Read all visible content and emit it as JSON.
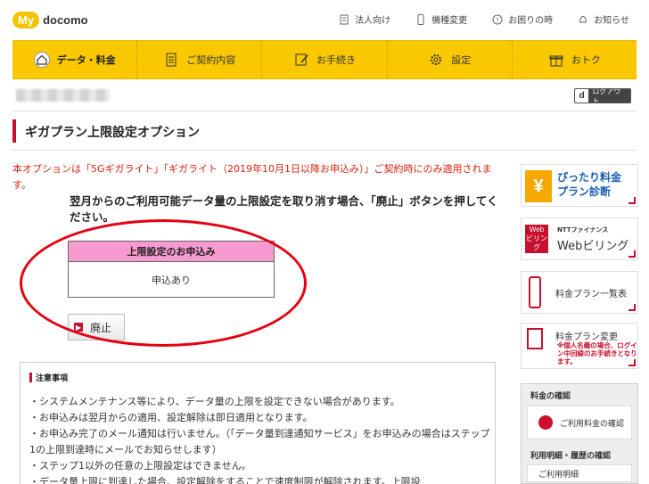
{
  "header": {
    "logo_my": "My",
    "logo_docomo": "docomo",
    "util": [
      {
        "label": "法人向け",
        "icon": "building-icon"
      },
      {
        "label": "機種変更",
        "icon": "smartphone-icon"
      },
      {
        "label": "お困りの時",
        "icon": "question-icon"
      },
      {
        "label": "お知らせ",
        "icon": "bell-icon"
      }
    ]
  },
  "nav": [
    {
      "label": "データ・料金",
      "icon": "home-icon"
    },
    {
      "label": "ご契約内容",
      "icon": "contract-icon"
    },
    {
      "label": "お手続き",
      "icon": "procedure-icon"
    },
    {
      "label": "設定",
      "icon": "gear-icon"
    },
    {
      "label": "おトク",
      "icon": "gift-icon"
    }
  ],
  "logout": {
    "d": "d",
    "label": "ログアウト"
  },
  "page_title": "ギガプラン上限設定オプション",
  "notice": "本オプションは「5Gギガライト」「ギガライト（2019年10月1日以降お申込み）」ご契約時にのみ適用されます。",
  "instruction": "翌月からのご利用可能データ量の上限設定を取り消す場合、「廃止」ボタンを押してください。",
  "status": {
    "header": "上限設定のお申込み",
    "value": "申込あり"
  },
  "cancel_button": "廃止",
  "notes": {
    "title": "注意事項",
    "items": [
      "・システムメンテナンス等により、データ量の上限を設定できない場合があります。",
      "・お申込みは翌月からの適用、設定解除は即日適用となります。",
      "・お申込み完了のメール通知は行いません。（「データ量到達通知サービス」をお申込みの場合はステップ1の上限到達時にメールでお知らせします）",
      "・ステップ1以外の任意の上限設定はできません。",
      "・データ量上限に到達した場合、設定解除をすることで速度制限が解除されます。上限設"
    ]
  },
  "sidebar": {
    "banner1": {
      "mark": "¥",
      "line1": "ぴったり料金",
      "line2": "プラン診断"
    },
    "banner2": {
      "mark": "Web ビリング",
      "line1": "NTTファイナンス",
      "line2": "Webビリング"
    },
    "banner3": {
      "text": "料金プラン一覧表"
    },
    "banner4": {
      "line1": "料金プラン変更",
      "line2": "※個人名義の場合、ログイン中回線のお手続きとなります。"
    },
    "box": {
      "head1": "料金の確認",
      "link1": "ご利用料金の確認",
      "head2": "利用明細・履歴の確認",
      "link2": "ご利用明細"
    }
  },
  "colors": {
    "brand_yellow": "#f9c800",
    "accent_red": "#c8102e",
    "highlight_pink": "#f79ad0",
    "annotation_red": "#e60012"
  }
}
